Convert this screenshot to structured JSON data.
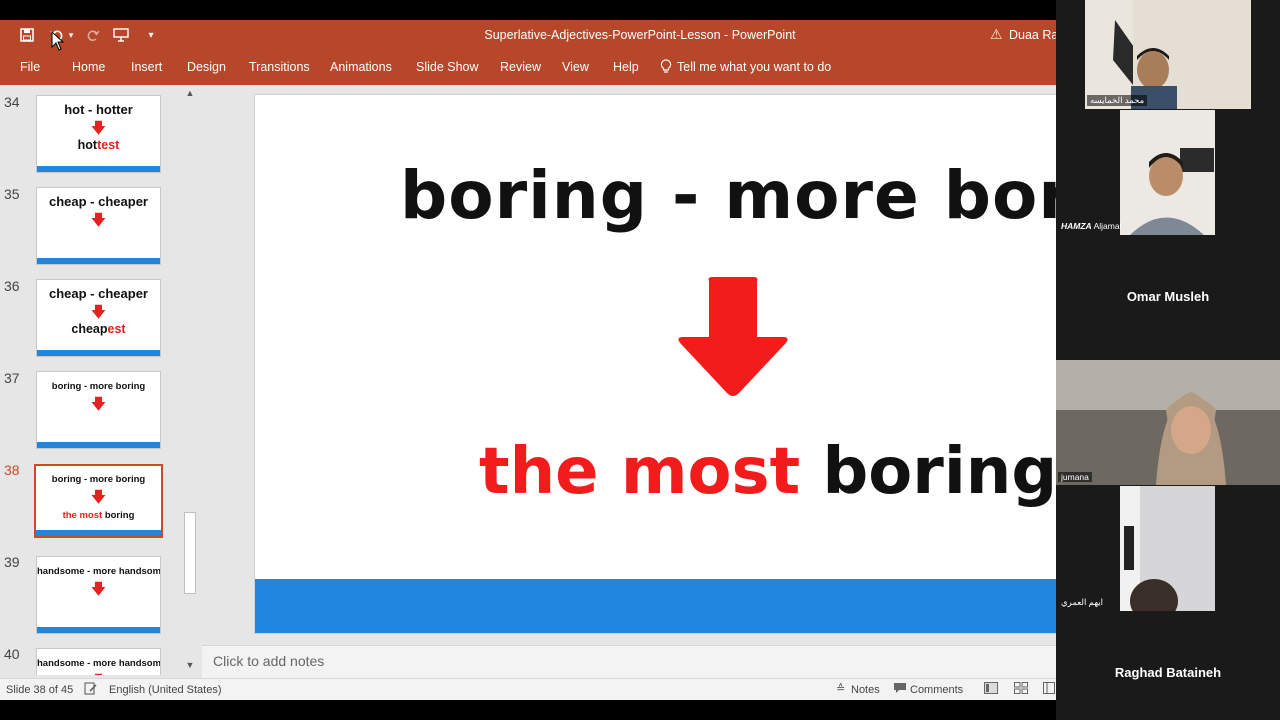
{
  "window": {
    "title": "Superlative-Adjectives-PowerPoint-Lesson  -  PowerPoint",
    "user": "Duaa Rab",
    "qat_icons": [
      "save-icon",
      "undo-icon",
      "redo-icon",
      "present-icon",
      "customize-icon"
    ]
  },
  "ribbon": {
    "tabs": [
      "File",
      "Home",
      "Insert",
      "Design",
      "Transitions",
      "Animations",
      "Slide Show",
      "Review",
      "View",
      "Help"
    ],
    "tell_me": "Tell me what you want to do"
  },
  "thumbnails": [
    {
      "num": "34",
      "title": "hot - hotter",
      "answer_base": "hot",
      "answer_suffix": "test",
      "answer_prefix": ""
    },
    {
      "num": "35",
      "title": "cheap - cheaper",
      "answer_base": "",
      "answer_suffix": "",
      "answer_prefix": ""
    },
    {
      "num": "36",
      "title": "cheap - cheaper",
      "answer_base": "cheap",
      "answer_suffix": "est",
      "answer_prefix": ""
    },
    {
      "num": "37",
      "title": "boring - more boring",
      "answer_base": "",
      "answer_suffix": "",
      "answer_prefix": ""
    },
    {
      "num": "38",
      "title": "boring - more boring",
      "answer_base": "boring",
      "answer_suffix": "",
      "answer_prefix": "the most"
    },
    {
      "num": "39",
      "title": "handsome - more handsome",
      "answer_base": "",
      "answer_suffix": "",
      "answer_prefix": ""
    },
    {
      "num": "40",
      "title": "handsome - more handsome",
      "answer_base": "",
      "answer_suffix": "",
      "answer_prefix": ""
    }
  ],
  "slide": {
    "title": "boring - more boring",
    "answer_prefix": "the most",
    "answer_word": "boring"
  },
  "notes": {
    "placeholder": "Click to add notes"
  },
  "status": {
    "slide_counter": "Slide 38 of 45",
    "language": "English (United States)",
    "notes_label": "Notes",
    "comments_label": "Comments"
  },
  "participants": [
    {
      "name": "محمد الخمايسه",
      "has_video": true
    },
    {
      "name": "Aljamal",
      "name_bold": "HAMZA",
      "has_video": true
    },
    {
      "name": "Omar Musleh",
      "has_video": false
    },
    {
      "name": "jumana",
      "has_video": true
    },
    {
      "name": "ايهم العمري",
      "has_video": true
    },
    {
      "name": "Raghad Bataineh",
      "has_video": false
    }
  ],
  "colors": {
    "ppt_accent": "#b7472a",
    "slide_red": "#f21c1c",
    "slide_blue": "#1f87e0",
    "selection": "#d24726"
  }
}
